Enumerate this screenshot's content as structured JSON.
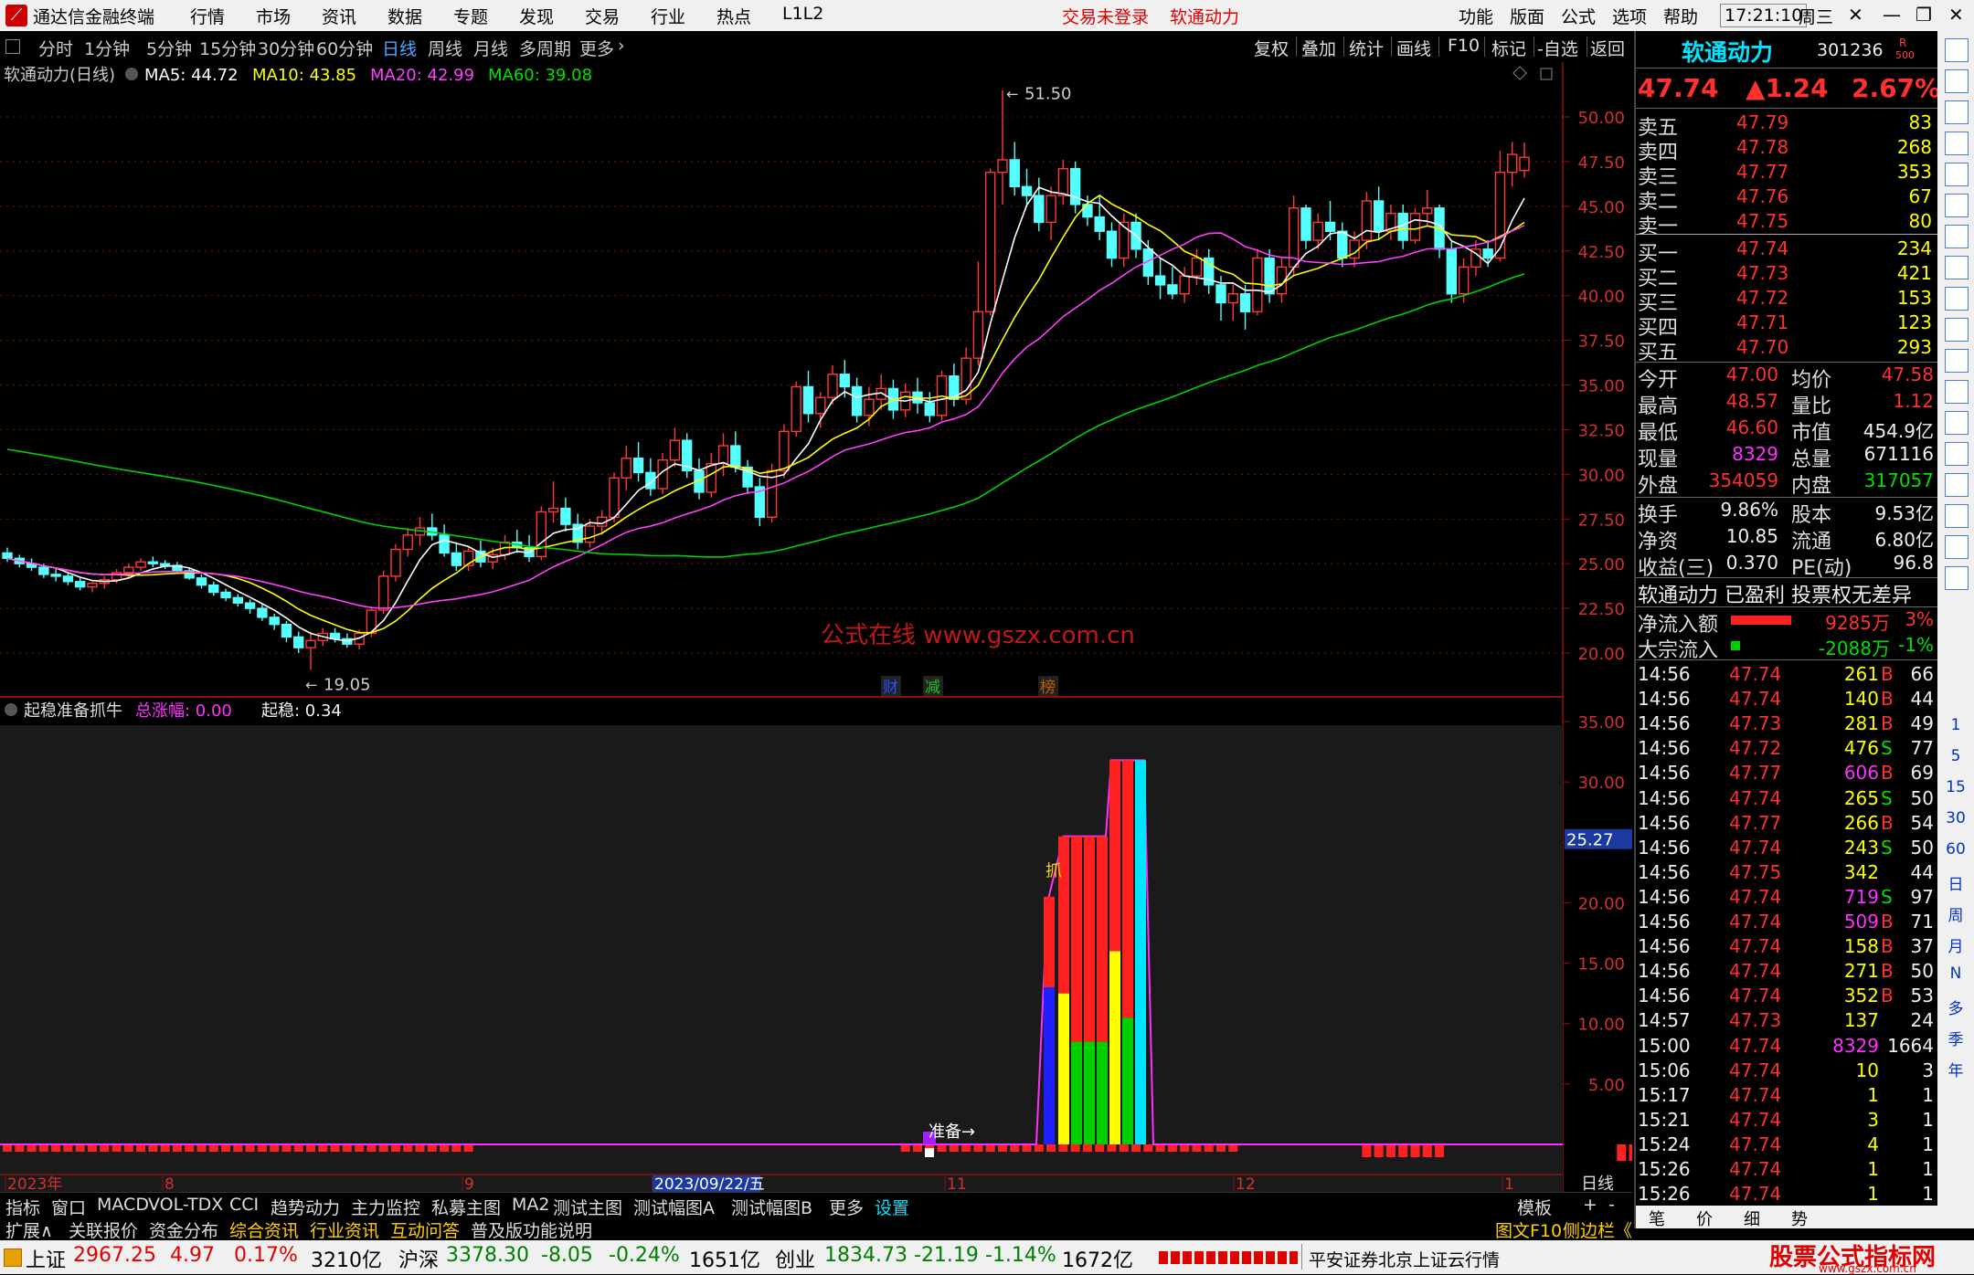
{
  "menubar": {
    "app_name": "通达信金融终端",
    "menu": [
      "行情",
      "市场",
      "资讯",
      "数据",
      "专题",
      "发现",
      "交易",
      "行业",
      "热点",
      "L1L2"
    ],
    "trade_status": "交易未登录",
    "stock_name": "软通动力",
    "right_menu": [
      "功能",
      "版面",
      "公式",
      "选项",
      "帮助"
    ],
    "time": "17:21:10",
    "weekday": "周三"
  },
  "toolbar": {
    "periods": [
      "分时",
      "1分钟",
      "5分钟",
      "15分钟",
      "30分钟",
      "60分钟",
      "日线",
      "周线",
      "月线",
      "多周期",
      "更多"
    ],
    "active": "日线",
    "more_arrow": "›",
    "right": [
      "复权",
      "叠加",
      "统计",
      "画线",
      "F10",
      "标记",
      "-自选",
      "返回"
    ]
  },
  "chart": {
    "title": "软通动力(日线)",
    "ma": [
      {
        "label": "MA5: 44.72",
        "color": "#ffffff"
      },
      {
        "label": "MA10: 43.85",
        "color": "#ffff00"
      },
      {
        "label": "MA20: 42.99",
        "color": "#ff40ff"
      },
      {
        "label": "MA60: 39.08",
        "color": "#00e000"
      }
    ],
    "high_label": "51.50",
    "low_label": "19.05",
    "watermark": "公式在线  www.gszx.com.cn",
    "markers": [
      "财",
      "减",
      "榜"
    ],
    "indicator_title": "起稳准备抓牛",
    "indicator_zf": "总涨幅: 0.00",
    "indicator_qw": "起稳: 0.34",
    "label_grab": "抓",
    "label_ready": "准备→",
    "x_labels": [
      "2023年",
      "8",
      "9",
      "2023/09/22/五",
      "11",
      "12",
      "1"
    ],
    "period_label": "日线",
    "cursor_value": "25.27"
  },
  "chart_data": [
    {
      "type": "candlestick",
      "title": "软通动力(日线)",
      "ylim": [
        19,
        52
      ],
      "yticks": [
        "50.00",
        "47.50",
        "45.00",
        "42.50",
        "40.00",
        "37.50",
        "35.00",
        "32.50",
        "30.00",
        "27.50",
        "25.00",
        "22.50",
        "20.00"
      ],
      "ohlc": [
        [
          25.6,
          25.9,
          25.1,
          25.3
        ],
        [
          25.3,
          25.5,
          24.8,
          25.0
        ],
        [
          25.0,
          25.3,
          24.6,
          24.8
        ],
        [
          24.8,
          25.0,
          24.2,
          24.4
        ],
        [
          24.4,
          24.7,
          24.0,
          24.3
        ],
        [
          24.3,
          24.5,
          23.8,
          24.0
        ],
        [
          24.0,
          24.2,
          23.5,
          23.7
        ],
        [
          23.7,
          24.0,
          23.4,
          23.9
        ],
        [
          23.9,
          24.3,
          23.6,
          24.1
        ],
        [
          24.1,
          24.7,
          23.9,
          24.5
        ],
        [
          24.5,
          25.0,
          24.2,
          24.8
        ],
        [
          24.8,
          25.3,
          24.6,
          25.1
        ],
        [
          25.1,
          25.4,
          24.8,
          25.0
        ],
        [
          25.0,
          25.2,
          24.7,
          24.9
        ],
        [
          24.9,
          25.1,
          24.5,
          24.6
        ],
        [
          24.6,
          24.8,
          24.1,
          24.2
        ],
        [
          24.2,
          24.4,
          23.6,
          23.8
        ],
        [
          23.8,
          24.0,
          23.2,
          23.4
        ],
        [
          23.4,
          23.6,
          22.9,
          23.1
        ],
        [
          23.1,
          23.3,
          22.6,
          22.8
        ],
        [
          22.8,
          23.0,
          22.2,
          22.5
        ],
        [
          22.5,
          22.7,
          21.8,
          22.0
        ],
        [
          22.0,
          22.2,
          21.3,
          21.6
        ],
        [
          21.6,
          21.8,
          20.6,
          20.9
        ],
        [
          20.9,
          21.2,
          20.0,
          20.3
        ],
        [
          20.3,
          21.2,
          19.05,
          20.7
        ],
        [
          20.7,
          21.4,
          20.4,
          21.1
        ],
        [
          21.1,
          21.4,
          20.6,
          20.8
        ],
        [
          20.8,
          21.1,
          20.3,
          20.5
        ],
        [
          20.5,
          21.3,
          20.2,
          21.1
        ],
        [
          21.1,
          22.6,
          20.9,
          22.4
        ],
        [
          22.4,
          24.6,
          22.2,
          24.3
        ],
        [
          24.3,
          26.1,
          24.0,
          25.8
        ],
        [
          25.8,
          27.0,
          25.4,
          26.6
        ],
        [
          26.6,
          27.6,
          26.0,
          27.0
        ],
        [
          27.0,
          27.8,
          26.3,
          26.6
        ],
        [
          26.6,
          27.2,
          25.4,
          25.6
        ],
        [
          25.6,
          26.2,
          24.6,
          24.9
        ],
        [
          24.9,
          26.0,
          24.6,
          25.7
        ],
        [
          25.7,
          26.3,
          24.8,
          25.1
        ],
        [
          25.1,
          25.9,
          24.7,
          25.5
        ],
        [
          25.5,
          26.6,
          25.2,
          26.2
        ],
        [
          26.2,
          26.9,
          25.6,
          25.9
        ],
        [
          25.9,
          26.6,
          25.1,
          25.4
        ],
        [
          25.4,
          28.2,
          25.2,
          27.9
        ],
        [
          27.9,
          29.6,
          27.3,
          28.1
        ],
        [
          28.1,
          28.7,
          26.8,
          27.2
        ],
        [
          27.2,
          27.8,
          25.8,
          26.2
        ],
        [
          26.2,
          27.5,
          25.9,
          27.1
        ],
        [
          27.1,
          28.0,
          26.6,
          27.6
        ],
        [
          27.6,
          30.1,
          27.3,
          29.8
        ],
        [
          29.8,
          31.6,
          29.1,
          30.9
        ],
        [
          30.9,
          31.8,
          29.6,
          30.1
        ],
        [
          30.1,
          30.9,
          28.8,
          29.2
        ],
        [
          29.2,
          31.2,
          28.9,
          30.8
        ],
        [
          30.8,
          32.6,
          30.4,
          31.9
        ],
        [
          31.9,
          32.3,
          29.8,
          30.2
        ],
        [
          30.2,
          30.9,
          28.6,
          29.0
        ],
        [
          29.0,
          31.2,
          28.7,
          30.6
        ],
        [
          30.6,
          32.3,
          29.9,
          31.6
        ],
        [
          31.6,
          32.4,
          30.1,
          30.4
        ],
        [
          30.4,
          30.8,
          28.9,
          29.3
        ],
        [
          29.3,
          29.8,
          27.1,
          27.6
        ],
        [
          27.6,
          30.6,
          27.3,
          30.2
        ],
        [
          30.2,
          32.8,
          29.8,
          32.4
        ],
        [
          32.4,
          35.2,
          32.1,
          34.9
        ],
        [
          34.9,
          35.8,
          32.9,
          33.4
        ],
        [
          33.4,
          34.6,
          32.6,
          34.3
        ],
        [
          34.3,
          36.1,
          33.9,
          35.6
        ],
        [
          35.6,
          36.4,
          34.3,
          34.9
        ],
        [
          34.9,
          35.4,
          32.9,
          33.3
        ],
        [
          33.3,
          34.9,
          32.7,
          34.2
        ],
        [
          34.2,
          35.6,
          33.6,
          34.8
        ],
        [
          34.8,
          35.3,
          33.1,
          33.6
        ],
        [
          33.6,
          35.1,
          33.2,
          34.6
        ],
        [
          34.6,
          35.4,
          33.4,
          34.0
        ],
        [
          34.0,
          34.6,
          32.9,
          33.3
        ],
        [
          33.3,
          35.8,
          33.0,
          35.5
        ],
        [
          35.5,
          36.2,
          33.8,
          34.2
        ],
        [
          34.2,
          37.1,
          33.9,
          36.5
        ],
        [
          36.5,
          41.9,
          36.1,
          39.1
        ],
        [
          39.1,
          47.1,
          38.9,
          46.9
        ],
        [
          46.9,
          51.5,
          45.1,
          47.6
        ],
        [
          47.6,
          48.6,
          45.6,
          46.1
        ],
        [
          46.1,
          47.1,
          45.1,
          45.6
        ],
        [
          45.6,
          46.6,
          43.6,
          44.1
        ],
        [
          44.1,
          46.1,
          43.1,
          45.6
        ],
        [
          45.6,
          47.6,
          45.1,
          47.1
        ],
        [
          47.1,
          47.5,
          44.6,
          45.1
        ],
        [
          45.1,
          45.6,
          43.9,
          44.4
        ],
        [
          44.4,
          45.6,
          43.1,
          43.6
        ],
        [
          43.6,
          44.1,
          41.6,
          42.1
        ],
        [
          42.1,
          44.6,
          41.6,
          44.1
        ],
        [
          44.1,
          44.6,
          42.1,
          42.6
        ],
        [
          42.6,
          43.1,
          40.6,
          41.1
        ],
        [
          41.1,
          42.1,
          39.8,
          40.6
        ],
        [
          40.6,
          41.6,
          39.8,
          40.1
        ],
        [
          40.1,
          41.6,
          39.6,
          41.1
        ],
        [
          41.1,
          42.6,
          40.6,
          42.1
        ],
        [
          42.1,
          42.6,
          40.1,
          40.6
        ],
        [
          40.6,
          41.1,
          38.6,
          39.6
        ],
        [
          39.6,
          40.6,
          38.6,
          40.1
        ],
        [
          40.1,
          40.6,
          38.1,
          39.1
        ],
        [
          39.1,
          42.6,
          38.9,
          42.1
        ],
        [
          42.1,
          42.6,
          39.6,
          40.1
        ],
        [
          40.1,
          42.1,
          39.6,
          41.6
        ],
        [
          41.6,
          45.6,
          41.1,
          44.9
        ],
        [
          44.9,
          45.1,
          42.6,
          43.1
        ],
        [
          43.1,
          44.6,
          42.6,
          44.1
        ],
        [
          44.1,
          45.3,
          43.1,
          43.6
        ],
        [
          43.6,
          44.1,
          41.6,
          42.1
        ],
        [
          42.1,
          43.6,
          41.6,
          43.1
        ],
        [
          43.1,
          45.8,
          42.6,
          45.3
        ],
        [
          45.3,
          46.1,
          43.1,
          43.6
        ],
        [
          43.6,
          45.1,
          43.1,
          44.6
        ],
        [
          44.6,
          45.1,
          42.6,
          43.1
        ],
        [
          43.1,
          44.9,
          42.9,
          44.6
        ],
        [
          44.6,
          45.9,
          43.9,
          44.9
        ],
        [
          44.9,
          45.1,
          42.1,
          42.6
        ],
        [
          42.6,
          43.1,
          39.6,
          40.1
        ],
        [
          40.1,
          42.1,
          39.6,
          41.6
        ],
        [
          41.6,
          43.1,
          41.1,
          42.6
        ],
        [
          42.6,
          43.1,
          41.6,
          42.1
        ],
        [
          42.1,
          48.1,
          41.9,
          46.9
        ],
        [
          46.9,
          48.6,
          46.1,
          47.9
        ],
        [
          47.0,
          48.57,
          46.6,
          47.74
        ]
      ],
      "ma_labels": [
        "MA5",
        "MA10",
        "MA20",
        "MA60"
      ]
    },
    {
      "type": "bar",
      "title": "起稳准备抓牛",
      "ylim": [
        0,
        35
      ],
      "yticks": [
        "35.00",
        "30.00",
        "25.00",
        "20.00",
        "15.00",
        "10.00",
        "5.00"
      ]
    }
  ],
  "quote": {
    "name": "软通动力",
    "code": "301236",
    "badge_top": "R",
    "badge_bottom": "500",
    "price": "47.74",
    "change": "▲1.24",
    "pct": "2.67%",
    "sell": [
      {
        "label": "卖五",
        "price": "47.79",
        "vol": "83"
      },
      {
        "label": "卖四",
        "price": "47.78",
        "vol": "268"
      },
      {
        "label": "卖三",
        "price": "47.77",
        "vol": "353"
      },
      {
        "label": "卖二",
        "price": "47.76",
        "vol": "67"
      },
      {
        "label": "卖一",
        "price": "47.75",
        "vol": "80"
      }
    ],
    "buy": [
      {
        "label": "买一",
        "price": "47.74",
        "vol": "234"
      },
      {
        "label": "买二",
        "price": "47.73",
        "vol": "421"
      },
      {
        "label": "买三",
        "price": "47.72",
        "vol": "153"
      },
      {
        "label": "买四",
        "price": "47.71",
        "vol": "123"
      },
      {
        "label": "买五",
        "price": "47.70",
        "vol": "293"
      }
    ],
    "stats": [
      {
        "l1": "今开",
        "v1": "47.00",
        "c1": "red",
        "l2": "均价",
        "v2": "47.58",
        "c2": "red"
      },
      {
        "l1": "最高",
        "v1": "48.57",
        "c1": "red",
        "l2": "量比",
        "v2": "1.12",
        "c2": "red"
      },
      {
        "l1": "最低",
        "v1": "46.60",
        "c1": "red",
        "l2": "市值",
        "v2": "454.9亿",
        "c2": "wht"
      },
      {
        "l1": "现量",
        "v1": "8329",
        "c1": "mag",
        "l2": "总量",
        "v2": "671116",
        "c2": "wht"
      },
      {
        "l1": "外盘",
        "v1": "354059",
        "c1": "red",
        "l2": "内盘",
        "v2": "317057",
        "c2": "grn"
      }
    ],
    "stats2": [
      {
        "l1": "换手",
        "v1": "9.86%",
        "l2": "股本",
        "v2": "9.53亿"
      },
      {
        "l1": "净资",
        "v1": "10.85",
        "l2": "流通",
        "v2": "6.80亿"
      },
      {
        "l1": "收益(三)",
        "v1": "0.370",
        "l2": "PE(动)",
        "v2": "96.8"
      }
    ],
    "tags": "软通动力 已盈利 投票权无差异",
    "flow": [
      {
        "label": "净流入额",
        "value": "9285万",
        "pct": "3%",
        "color": "red"
      },
      {
        "label": "大宗流入",
        "value": "-2088万",
        "pct": "-1%",
        "color": "grn"
      }
    ],
    "ticks": [
      {
        "t": "14:56",
        "p": "47.74",
        "v": "261",
        "d": "B",
        "n": "66",
        "vc": "yel"
      },
      {
        "t": "14:56",
        "p": "47.74",
        "v": "140",
        "d": "B",
        "n": "44",
        "vc": "yel"
      },
      {
        "t": "14:56",
        "p": "47.73",
        "v": "281",
        "d": "B",
        "n": "49",
        "vc": "yel"
      },
      {
        "t": "14:56",
        "p": "47.72",
        "v": "476",
        "d": "S",
        "n": "77",
        "vc": "yel"
      },
      {
        "t": "14:56",
        "p": "47.77",
        "v": "606",
        "d": "B",
        "n": "69",
        "vc": "mag"
      },
      {
        "t": "14:56",
        "p": "47.74",
        "v": "265",
        "d": "S",
        "n": "50",
        "vc": "yel"
      },
      {
        "t": "14:56",
        "p": "47.77",
        "v": "266",
        "d": "B",
        "n": "54",
        "vc": "yel"
      },
      {
        "t": "14:56",
        "p": "47.74",
        "v": "243",
        "d": "S",
        "n": "50",
        "vc": "yel"
      },
      {
        "t": "14:56",
        "p": "47.75",
        "v": "342",
        "d": "",
        "n": "44",
        "vc": "yel"
      },
      {
        "t": "14:56",
        "p": "47.74",
        "v": "719",
        "d": "S",
        "n": "97",
        "vc": "mag"
      },
      {
        "t": "14:56",
        "p": "47.74",
        "v": "509",
        "d": "B",
        "n": "71",
        "vc": "mag"
      },
      {
        "t": "14:56",
        "p": "47.74",
        "v": "158",
        "d": "B",
        "n": "37",
        "vc": "yel"
      },
      {
        "t": "14:56",
        "p": "47.74",
        "v": "271",
        "d": "B",
        "n": "50",
        "vc": "yel"
      },
      {
        "t": "14:56",
        "p": "47.74",
        "v": "352",
        "d": "B",
        "n": "53",
        "vc": "yel"
      },
      {
        "t": "14:57",
        "p": "47.73",
        "v": "137",
        "d": "",
        "n": "24",
        "vc": "yel"
      },
      {
        "t": "15:00",
        "p": "47.74",
        "v": "8329",
        "d": "",
        "n": "1664",
        "vc": "mag"
      },
      {
        "t": "15:06",
        "p": "47.74",
        "v": "10",
        "d": "",
        "n": "3",
        "vc": "yel"
      },
      {
        "t": "15:17",
        "p": "47.74",
        "v": "1",
        "d": "",
        "n": "1",
        "vc": "yel"
      },
      {
        "t": "15:21",
        "p": "47.74",
        "v": "3",
        "d": "",
        "n": "1",
        "vc": "yel"
      },
      {
        "t": "15:24",
        "p": "47.74",
        "v": "4",
        "d": "",
        "n": "1",
        "vc": "yel"
      },
      {
        "t": "15:26",
        "p": "47.74",
        "v": "1",
        "d": "",
        "n": "1",
        "vc": "yel"
      },
      {
        "t": "15:26",
        "p": "47.74",
        "v": "1",
        "d": "",
        "n": "1",
        "vc": "yel"
      }
    ],
    "bottom_tabs": [
      "笔",
      "价",
      "细",
      "势"
    ]
  },
  "strip": {
    "icons": [
      "up-arrow-icon",
      "down-arrow-icon",
      "chart-icon",
      "table-icon",
      "line-chart-icon",
      "candle-icon",
      "list-icon",
      "f10-icon",
      "f11-icon",
      "f12-icon",
      "f13-icon",
      "circle-icon",
      "rsi-icon",
      "rsi-label",
      "move-icon",
      "pen-icon",
      "f5-icon",
      "fs-icon"
    ],
    "labels": [
      "1",
      "5",
      "15",
      "30",
      "60",
      "日",
      "周",
      "月",
      "N",
      "多",
      "季",
      "年"
    ]
  },
  "tabs1": [
    "指标",
    "窗口",
    "MACD",
    "VOL-TDX",
    "CCI",
    "趋势动力",
    "主力监控",
    "私募主图",
    "MA2",
    "测试主图",
    "测试幅图A",
    "测试幅图B",
    "更多",
    "设置"
  ],
  "tabs1_right": [
    "模板",
    "+",
    "-"
  ],
  "tabs2": [
    "扩展∧",
    "关联报价",
    "资金分布",
    "综合资讯",
    "行业资讯",
    "互动问答",
    "普及版功能说明"
  ],
  "tabs2_right": [
    "图文F10",
    "侧边栏《"
  ],
  "status": {
    "sh": {
      "name": "上证",
      "val": "2967.25",
      "chg": "4.97",
      "pct": "0.17%",
      "amt": "3210亿"
    },
    "hs": {
      "name": "沪深",
      "val": "3378.30",
      "chg": "-8.05",
      "pct": "-0.24%",
      "amt": "1651亿"
    },
    "cy": {
      "name": "创业",
      "val": "1834.73",
      "chg": "-21.19",
      "pct": "-1.14%",
      "amt": "1672亿"
    },
    "broker": "平安证券北京上证云行情",
    "brand": "股票公式指标网",
    "brand_url": "www.gszx.com.cn"
  }
}
